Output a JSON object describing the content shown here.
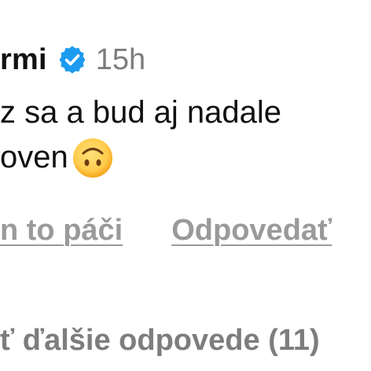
{
  "comment": {
    "username": "rmi",
    "verified": true,
    "timestamp": "15h",
    "text_line1": "z sa a bud aj nadale",
    "text_line2": "oven",
    "emoji": "upside-down-face",
    "like_action": "n to páči",
    "reply_action": "Odpovedať",
    "more_replies": "ť ďalšie odpovede (11)"
  },
  "colors": {
    "verified_blue": "#1d9bf0",
    "muted_text": "#7d7d7d",
    "action_text": "#9a9a9a",
    "emoji_yellow": "#ffcc4d"
  },
  "icons": {
    "verified": "verified-badge-icon",
    "emoji": "upside-down-face-emoji-icon"
  }
}
